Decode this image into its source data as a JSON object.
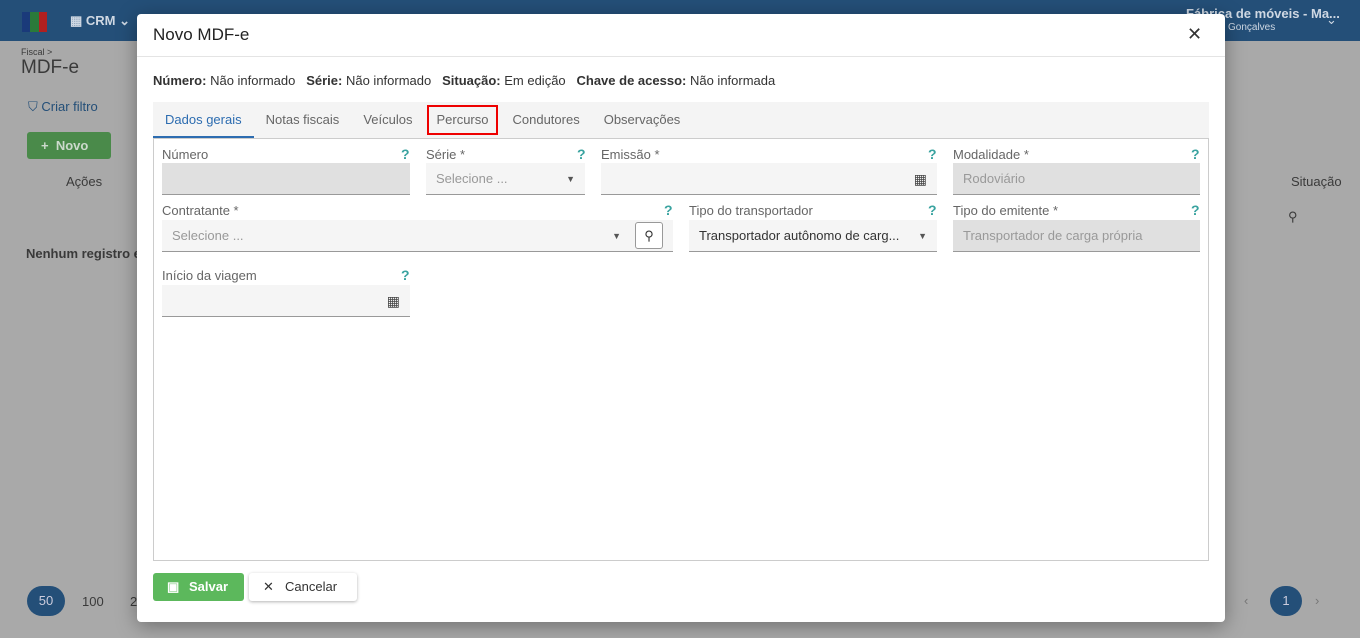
{
  "topbar": {
    "app": "CRM",
    "company": "Fábrica de móveis - Ma...",
    "user": "Gonçalves"
  },
  "background": {
    "breadcrumb": "Fiscal >",
    "page_title": "MDF-e",
    "create_filter": "Criar filtro",
    "new_button": "Novo",
    "col_actions": "Ações",
    "col_status": "Situação",
    "empty": "Nenhum registro e",
    "page_sizes": [
      "50",
      "100",
      "2"
    ],
    "current_page": "1"
  },
  "modal": {
    "title": "Novo MDF-e",
    "info": [
      {
        "label": "Número:",
        "value": "Não informado"
      },
      {
        "label": "Série:",
        "value": "Não informado"
      },
      {
        "label": "Situação:",
        "value": "Em edição"
      },
      {
        "label": "Chave de acesso:",
        "value": "Não informada"
      }
    ],
    "tabs": [
      "Dados gerais",
      "Notas fiscais",
      "Veículos",
      "Percurso",
      "Condutores",
      "Observações"
    ],
    "fields": {
      "numero": {
        "label": "Número",
        "value": ""
      },
      "serie": {
        "label": "Série *",
        "placeholder": "Selecione ..."
      },
      "emissao": {
        "label": "Emissão *",
        "value": ""
      },
      "modalidade": {
        "label": "Modalidade *",
        "value": "Rodoviário"
      },
      "contratante": {
        "label": "Contratante *",
        "placeholder": "Selecione ..."
      },
      "tipo_transportador": {
        "label": "Tipo do transportador",
        "value": "Transportador autônomo de carg..."
      },
      "tipo_emitente": {
        "label": "Tipo do emitente *",
        "value": "Transportador de carga própria"
      },
      "inicio_viagem": {
        "label": "Início da viagem",
        "value": ""
      }
    },
    "help": "?",
    "save": "Salvar",
    "cancel": "Cancelar"
  }
}
